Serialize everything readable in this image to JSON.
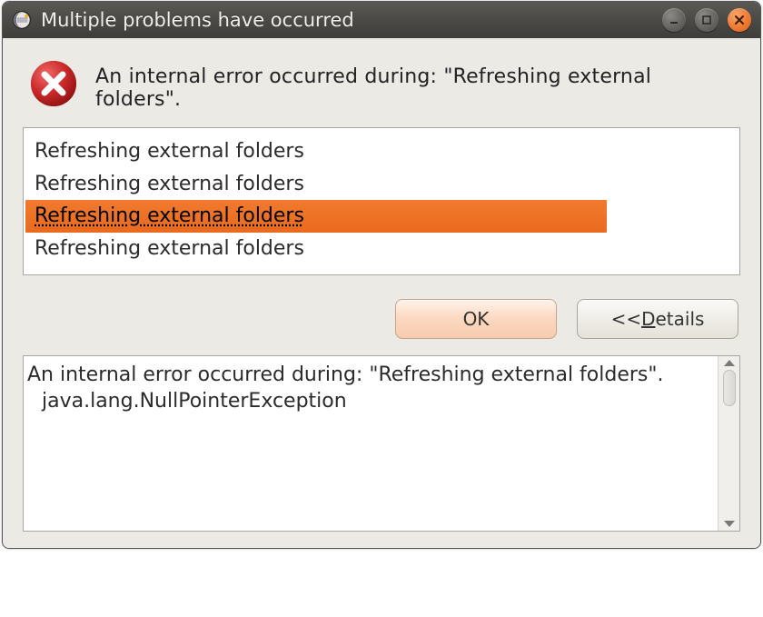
{
  "titlebar": {
    "title": "Multiple problems have occurred"
  },
  "message": {
    "text": "An internal error occurred during: \"Refreshing external folders\"."
  },
  "list": {
    "items": [
      {
        "label": "Refreshing external folders",
        "selected": false
      },
      {
        "label": "Refreshing external folders",
        "selected": false
      },
      {
        "label": "Refreshing external folders",
        "selected": true
      },
      {
        "label": "Refreshing external folders",
        "selected": false
      }
    ]
  },
  "buttons": {
    "ok": "OK",
    "details_prefix": "<< ",
    "details_underline": "D",
    "details_rest": "etails"
  },
  "details": {
    "line1": "An internal error occurred during: \"Refreshing external folders\".",
    "line2": "java.lang.NullPointerException"
  }
}
